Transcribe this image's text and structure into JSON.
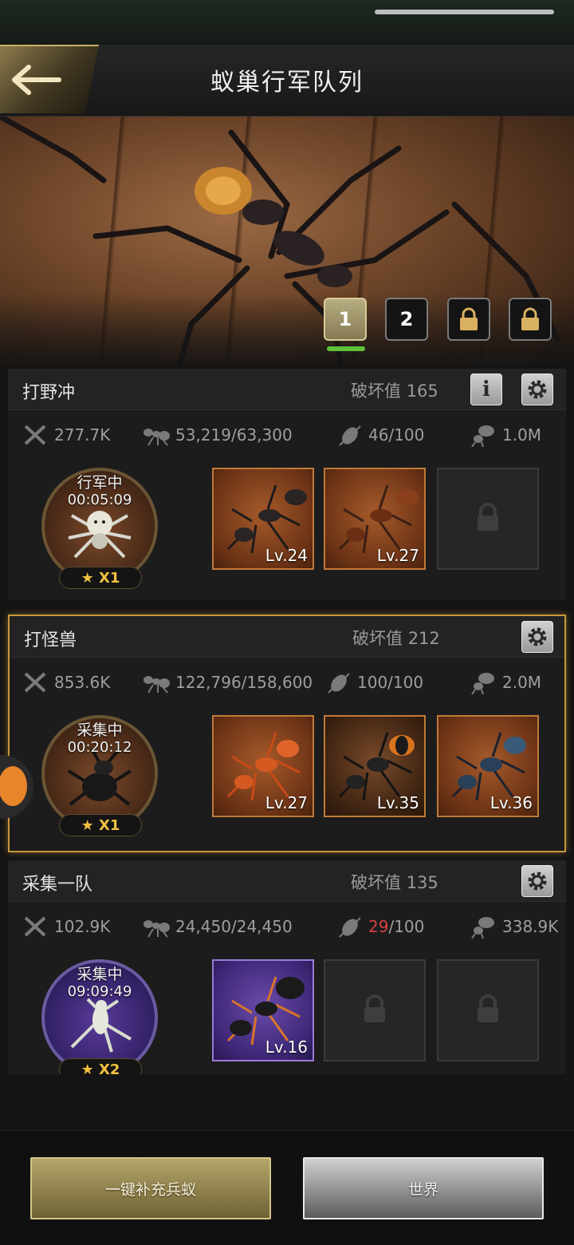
{
  "header": {
    "title": "蚁巢行军队列",
    "back_label": ""
  },
  "banner": {
    "tabs": [
      {
        "label": "1",
        "active": true,
        "locked": false
      },
      {
        "label": "2",
        "active": false,
        "locked": false
      },
      {
        "label": "",
        "active": false,
        "locked": true,
        "icon": "lock-icon"
      },
      {
        "label": "",
        "active": false,
        "locked": true,
        "icon": "lock-icon"
      }
    ]
  },
  "squads": [
    {
      "name": "打野冲",
      "power_label": "破坏值",
      "power_value": "165",
      "has_info": true,
      "stats": {
        "attack": "277.7K",
        "troops": "53,219/63,300",
        "load": "46/100",
        "load_warn": false,
        "capacity": "1.0M"
      },
      "leader": {
        "status": "行军中",
        "timer": "00:05:09",
        "stars": "★ X1",
        "creature": "spider",
        "frame": "bronze"
      },
      "slots": [
        {
          "level": "Lv.24",
          "locked": false
        },
        {
          "level": "Lv.27",
          "locked": false
        },
        {
          "level": "",
          "locked": true
        }
      ]
    },
    {
      "name": "打怪兽",
      "power_label": "破坏值",
      "power_value": "212",
      "has_info": false,
      "stats": {
        "attack": "853.6K",
        "troops": "122,796/158,600",
        "load": "100/100",
        "load_warn": false,
        "capacity": "2.0M"
      },
      "leader": {
        "status": "采集中",
        "timer": "00:20:12",
        "stars": "★ X1",
        "creature": "beetle",
        "frame": "bronze"
      },
      "slots": [
        {
          "level": "Lv.27",
          "locked": false
        },
        {
          "level": "Lv.35",
          "locked": false
        },
        {
          "level": "Lv.36",
          "locked": false
        }
      ]
    },
    {
      "name": "采集一队",
      "power_label": "破坏值",
      "power_value": "135",
      "has_info": false,
      "stats": {
        "attack": "102.9K",
        "troops": "24,450/24,450",
        "load_num": "29",
        "load_den": "/100",
        "load_warn": true,
        "capacity": "338.9K"
      },
      "leader": {
        "status": "采集中",
        "timer": "09:09:49",
        "stars": "★ X2",
        "creature": "mantis",
        "frame": "purple"
      },
      "slots": [
        {
          "level": "Lv.16",
          "locked": false
        },
        {
          "level": "",
          "locked": true
        },
        {
          "level": "",
          "locked": true
        }
      ]
    }
  ],
  "footer": {
    "refill_label": "一键补充兵蚁",
    "world_label": "世界"
  },
  "colors": {
    "accent_gold": "#c8963c",
    "active_tab": "#5fc03a",
    "warn": "#d84040"
  }
}
